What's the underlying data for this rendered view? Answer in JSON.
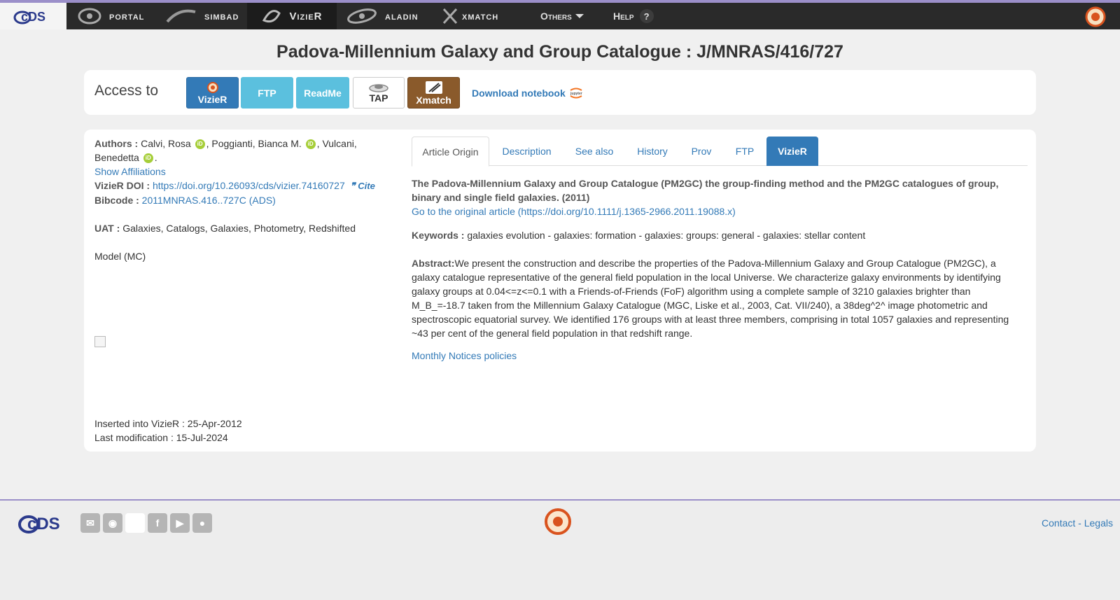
{
  "nav": {
    "portal": "portal",
    "simbad": "simbad",
    "vizier": "VizieR",
    "aladin": "aladin",
    "xmatch": "xmatch",
    "others": "Others",
    "help": "Help",
    "help_q": "?"
  },
  "title": "Padova-Millennium Galaxy and Group Catalogue : J/MNRAS/416/727",
  "access": {
    "label": "Access to",
    "vizier": "VizieR",
    "ftp": "FTP",
    "readme": "ReadMe",
    "tap": "TAP",
    "xmatch": "Xmatch",
    "download_notebook": "Download notebook"
  },
  "left": {
    "authors_label": "Authors :",
    "author1": "Calvi, Rosa",
    "author2": ", Poggianti, Bianca M.",
    "author3": ", Vulcani, Benedetta",
    "author_end": ".",
    "show_affiliations": "Show Affiliations",
    "doi_label": "VizieR DOI :",
    "doi": "https://doi.org/10.26093/cds/vizier.74160727",
    "cite": "Cite",
    "bibcode_label": "Bibcode :",
    "bibcode": "2011MNRAS.416..727C (ADS)",
    "uat_label": "UAT :",
    "uat": "Galaxies, Catalogs, Galaxies, Photometry, Redshifted",
    "model": "Model (MC)",
    "inserted": "Inserted into VizieR : 25-Apr-2012",
    "modified": "Last modification : 15-Jul-2024"
  },
  "tabs": [
    "Article Origin",
    "Description",
    "See also",
    "History",
    "Prov",
    "FTP",
    "VizieR"
  ],
  "article": {
    "title": "The Padova-Millennium Galaxy and Group Catalogue (PM2GC) the group-finding method and the PM2GC catalogues of group, binary and single field galaxies. (2011)",
    "link": "Go to the original article (https://doi.org/10.1111/j.1365-2966.2011.19088.x)",
    "keywords_label": "Keywords :",
    "keywords": "galaxies evolution - galaxies: formation - galaxies: groups: general - galaxies: stellar content",
    "abstract_label": "Abstract:",
    "abstract": "We present the construction and describe the properties of the Padova-Millennium Galaxy and Group Catalogue (PM2GC), a galaxy catalogue representative of the general field population in the local Universe. We characterize galaxy environments by identifying galaxy groups at 0.04<=z<=0.1 with a Friends-of-Friends (FoF) algorithm using a complete sample of 3210 galaxies brighter than M_B_=-18.7 taken from the Millennium Galaxy Catalogue (MGC, Liske et al., 2003, Cat. VII/240), a 38deg^2^ image photometric and spectroscopic equatorial survey. We identified 176 groups with at least three members, comprising in total 1057 galaxies and representing ~43 per cent of the general field population in that redshift range.",
    "policies": "Monthly Notices policies"
  },
  "footer": {
    "contact": "Contact",
    "sep": " - ",
    "legals": "Legals"
  }
}
